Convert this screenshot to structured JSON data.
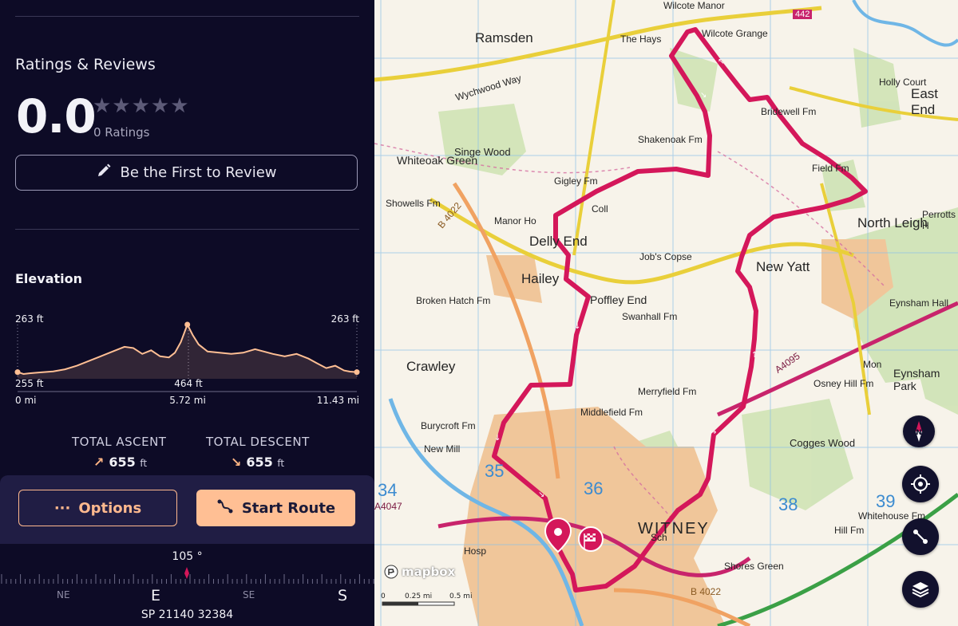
{
  "ratings": {
    "title": "Ratings & Reviews",
    "value": "0.0",
    "stars": "★★★★★",
    "count": "0 Ratings",
    "review_button": "Be the First to Review"
  },
  "elevation": {
    "title": "Elevation",
    "start_label": "263 ft",
    "end_label": "263 ft",
    "min_label": "255 ft",
    "max_label": "464 ft",
    "x_start": "0 mi",
    "x_mid": "5.72 mi",
    "x_end": "11.43 mi"
  },
  "chart_data": {
    "type": "area",
    "x": [
      0,
      0.2,
      0.4,
      0.8,
      1.2,
      1.6,
      2.0,
      2.4,
      2.8,
      3.2,
      3.6,
      3.9,
      4.2,
      4.5,
      4.8,
      5.1,
      5.3,
      5.5,
      5.72,
      5.9,
      6.1,
      6.4,
      6.8,
      7.2,
      7.6,
      8.0,
      8.3,
      8.6,
      9.0,
      9.4,
      9.8,
      10.1,
      10.4,
      10.7,
      11.0,
      11.2,
      11.43
    ],
    "y": [
      263,
      255,
      258,
      262,
      266,
      275,
      290,
      310,
      330,
      350,
      370,
      365,
      340,
      355,
      330,
      325,
      345,
      390,
      464,
      420,
      380,
      350,
      345,
      340,
      345,
      360,
      350,
      340,
      330,
      340,
      320,
      300,
      280,
      290,
      270,
      265,
      263
    ],
    "xlabel": "",
    "ylabel": "",
    "colors": {
      "line": "#ffbf94",
      "fill": "#ffbf94"
    }
  },
  "stats": {
    "ascent_label": "TOTAL ASCENT",
    "ascent_value": "655",
    "descent_label": "TOTAL DESCENT",
    "descent_value": "655",
    "unit": "ft",
    "ascent_arrow": "↗",
    "descent_arrow": "↘"
  },
  "actions": {
    "options_icon": "···",
    "options_label": "Options",
    "start_label": "Start Route"
  },
  "compass": {
    "heading": "105 °",
    "ne": "NE",
    "e": "E",
    "se": "SE",
    "s": "S",
    "grid_ref": "SP 21140 32384"
  },
  "map": {
    "labels": {
      "ramsden": "Ramsden",
      "the_hays": "The Hays",
      "wilcote_manor": "Wilcote Manor",
      "wilcote_grange": "Wilcote Grange",
      "holly_court": "Holly Court",
      "east_end": "East End",
      "bridewell": "Bridewell Fm",
      "wychwood_way": "Wychwood Way",
      "whiteoak_green": "Whiteoak Green",
      "singe_wood": "Singe Wood",
      "shakenoak": "Shakenoak Fm",
      "gigley": "Gigley Fm",
      "field_fm": "Field Fm",
      "north_leigh": "North Leigh",
      "perrotts": "Perrotts H",
      "showells": "Showells Fm",
      "b4022": "B 4022",
      "manor_ho": "Manor Ho",
      "coll": "Coll",
      "delly_end": "Delly End",
      "jobs_copse": "Job's Copse",
      "new_yatt": "New Yatt",
      "broken_hatch": "Broken Hatch Fm",
      "hailey": "Hailey",
      "poffley_end": "Poffley End",
      "swanhall": "Swanhall Fm",
      "eynsham_hall": "Eynsham Hall",
      "crawley": "Crawley",
      "a4095": "A4095",
      "osney_hill": "Osney Hill Fm",
      "merryfield": "Merryfield Fm",
      "eynsham_park": "Eynsham Park",
      "burycroft": "Burycroft Fm",
      "middlefield": "Middlefield Fm",
      "cogges_wood": "Cogges Wood",
      "new_mill": "New Mill",
      "witney": "WITNEY",
      "whitehouse": "Whitehouse Fm",
      "hill_fm": "Hill Fm",
      "shores_green": "Shores Green",
      "b4022_south": "B 4022",
      "hosp": "Hosp",
      "a4047": "A4047",
      "mon": "Mon",
      "sch": "Sch",
      "grid_34": "34",
      "grid_35": "35",
      "grid_36": "36",
      "grid_38": "38",
      "grid_39": "39",
      "road_442": "442"
    },
    "mapbox": "mapbox",
    "scale": {
      "zero": "0",
      "mid": "0.25 mi",
      "end": "0.5 mi"
    },
    "compass_letter": "N",
    "route_color": "#d4175a"
  },
  "icons": {
    "pencil": "pencil-icon",
    "route": "route-icon",
    "locate": "crosshair-icon",
    "layers": "layers-icon"
  }
}
